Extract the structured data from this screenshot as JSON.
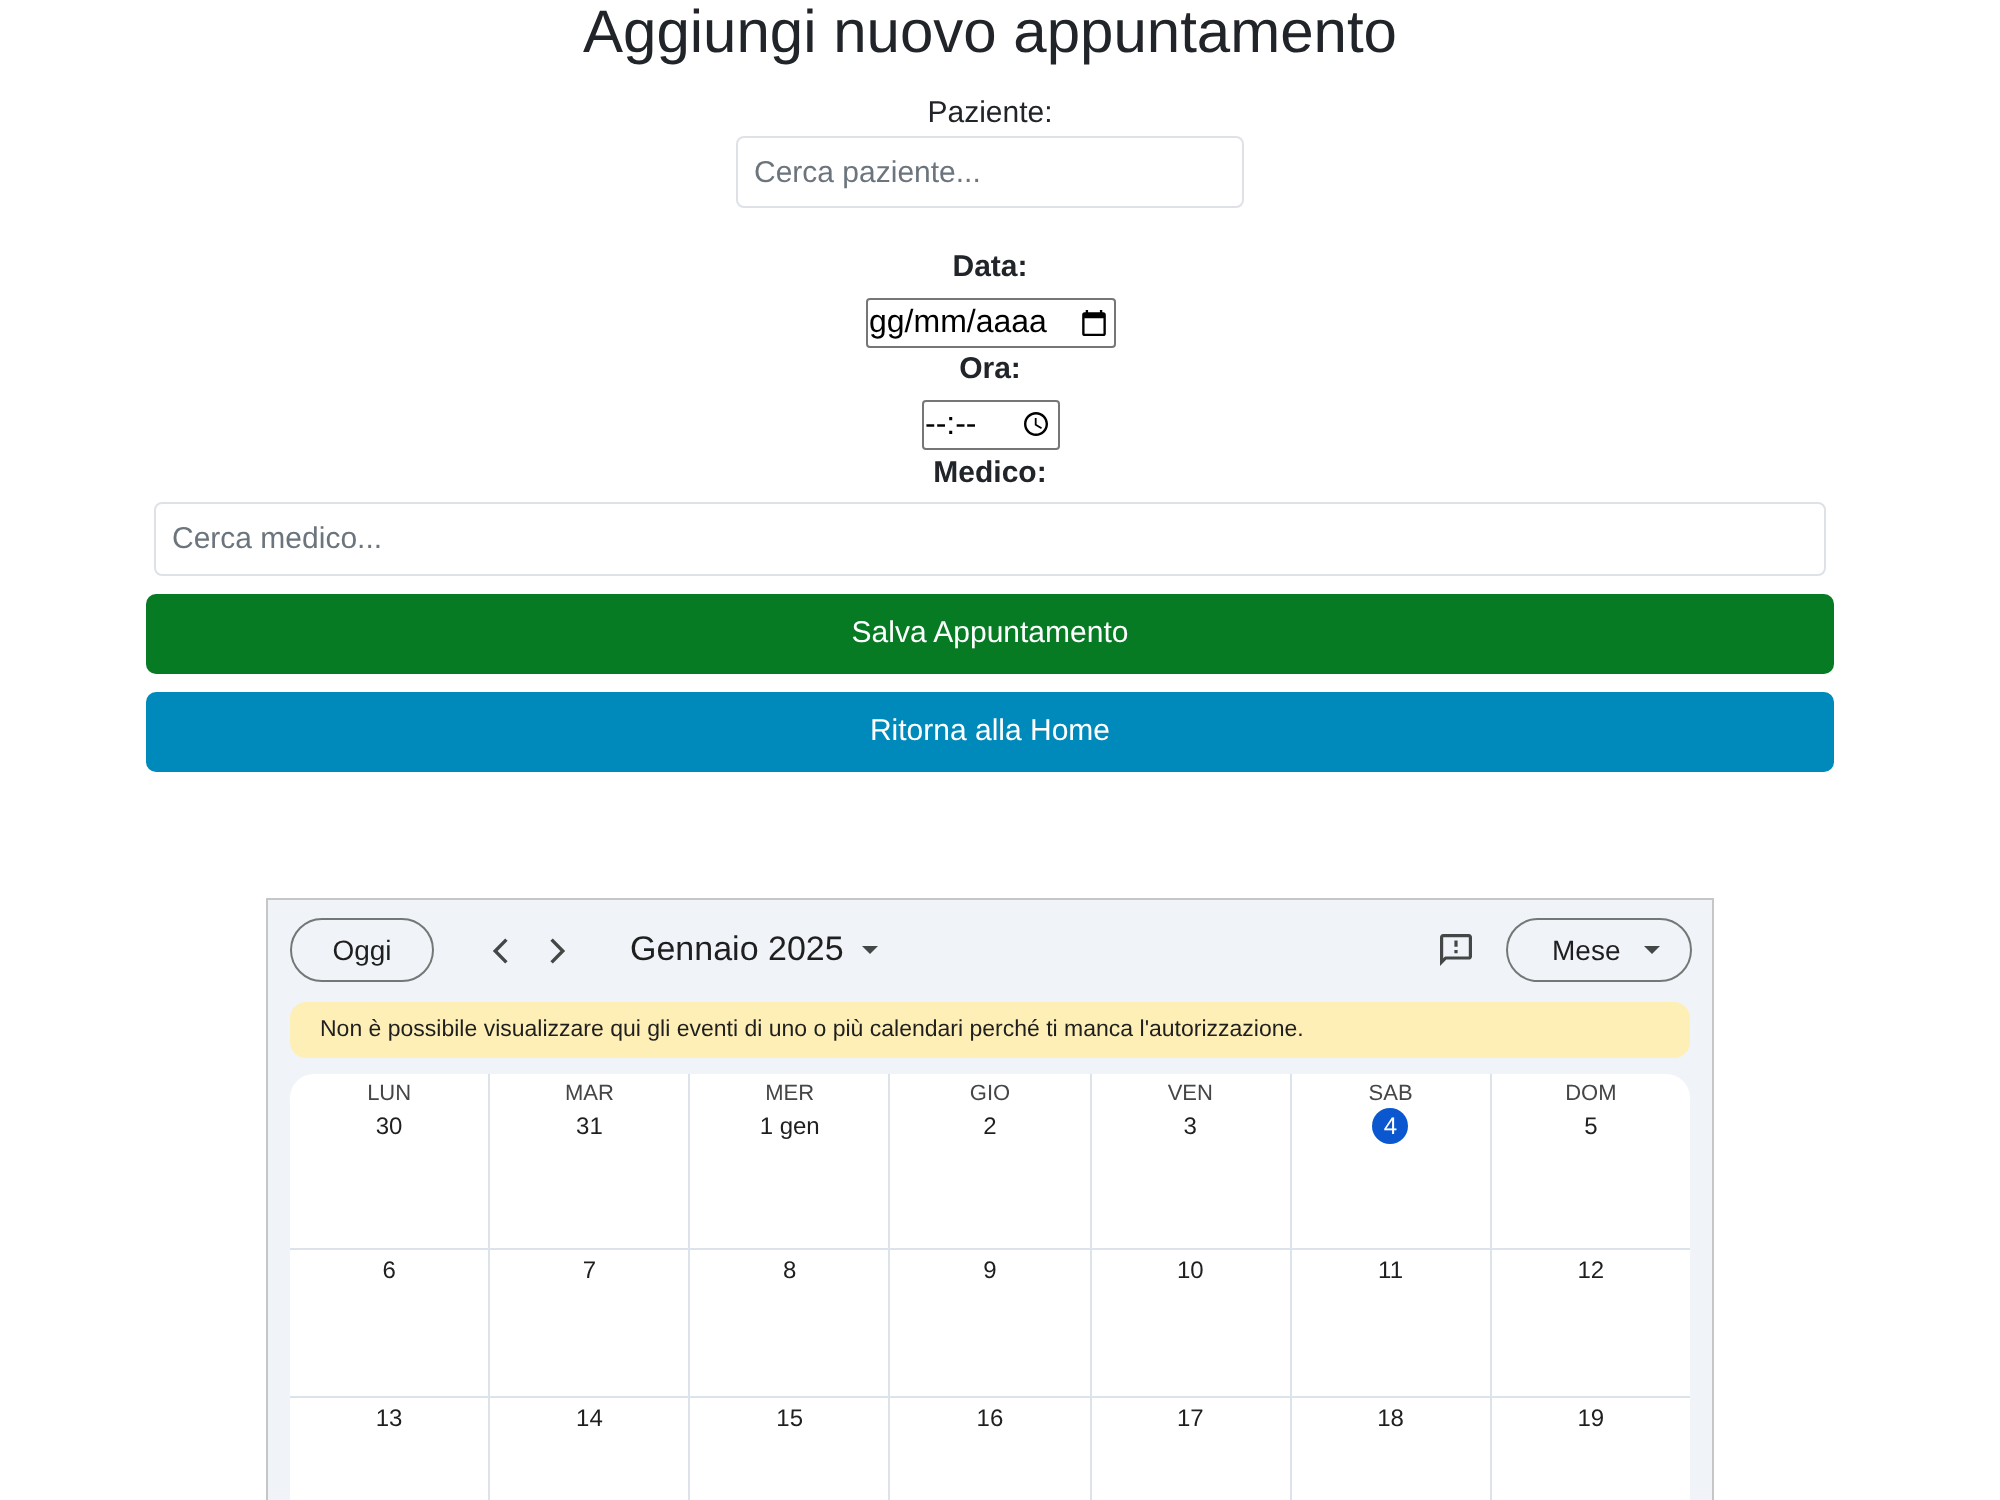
{
  "page": {
    "title": "Aggiungi nuovo appuntamento"
  },
  "form": {
    "fields": [
      {
        "kind": "search",
        "label": "Paziente:",
        "label_bold": false,
        "placeholder": "Cerca paziente..."
      },
      {
        "kind": "date",
        "label": "Data:",
        "label_bold": true,
        "placeholder": "gg/mm/aaaa"
      },
      {
        "kind": "time",
        "label": "Ora:",
        "label_bold": true,
        "placeholder": "--:--"
      },
      {
        "kind": "wide",
        "label": "Medico:",
        "label_bold": true,
        "placeholder": "Cerca medico..."
      }
    ],
    "buttons": [
      {
        "kind": "success",
        "label": "Salva Appuntamento"
      },
      {
        "kind": "info",
        "label": "Ritorna alla Home"
      }
    ]
  },
  "calendar": {
    "today_button": "Oggi",
    "month_label": "Gennaio 2025",
    "view_button": "Mese",
    "notice": "Non è possibile visualizzare qui gli eventi di uno o più calendari perché ti manca l'autorizzazione.",
    "weekdays": [
      "LUN",
      "MAR",
      "MER",
      "GIO",
      "VEN",
      "SAB",
      "DOM"
    ],
    "weeks": [
      [
        {
          "day": "30",
          "today": false
        },
        {
          "day": "31",
          "today": false
        },
        {
          "day": "1 gen",
          "today": false
        },
        {
          "day": "2",
          "today": false
        },
        {
          "day": "3",
          "today": false
        },
        {
          "day": "4",
          "today": true
        },
        {
          "day": "5",
          "today": false
        }
      ],
      [
        {
          "day": "6",
          "today": false
        },
        {
          "day": "7",
          "today": false
        },
        {
          "day": "8",
          "today": false
        },
        {
          "day": "9",
          "today": false
        },
        {
          "day": "10",
          "today": false
        },
        {
          "day": "11",
          "today": false
        },
        {
          "day": "12",
          "today": false
        }
      ],
      [
        {
          "day": "13",
          "today": false
        },
        {
          "day": "14",
          "today": false
        },
        {
          "day": "15",
          "today": false
        },
        {
          "day": "16",
          "today": false
        },
        {
          "day": "17",
          "today": false
        },
        {
          "day": "18",
          "today": false
        },
        {
          "day": "19",
          "today": false
        }
      ]
    ]
  }
}
